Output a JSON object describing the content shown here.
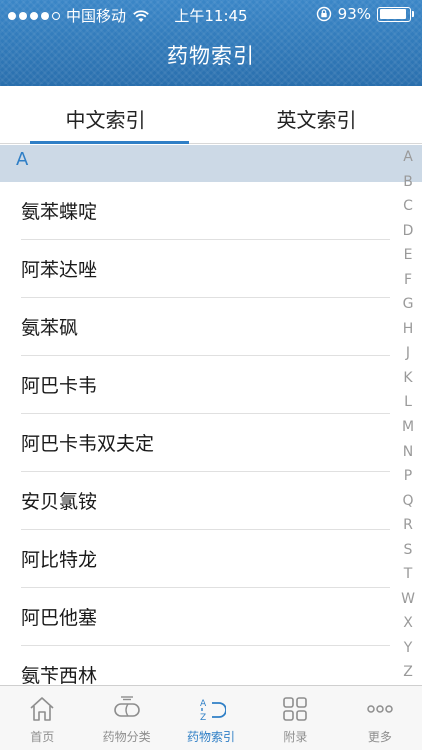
{
  "status_bar": {
    "carrier": "中国移动",
    "time": "上午11:45",
    "battery": "93%",
    "battery_level": 0.93
  },
  "header": {
    "title": "药物索引"
  },
  "tabs": [
    {
      "label": "中文索引"
    },
    {
      "label": "英文索引"
    }
  ],
  "section": {
    "letter": "A"
  },
  "items": [
    "氨苯蝶啶",
    "阿苯达唑",
    "氨苯砜",
    "阿巴卡韦",
    "阿巴卡韦双夫定",
    "安贝氯铵",
    "阿比特龙",
    "阿巴他塞",
    "氨苄西林"
  ],
  "alphabet": [
    "A",
    "B",
    "C",
    "D",
    "E",
    "F",
    "G",
    "H",
    "J",
    "K",
    "L",
    "M",
    "N",
    "P",
    "Q",
    "R",
    "S",
    "T",
    "W",
    "X",
    "Y",
    "Z"
  ],
  "tabbar": [
    {
      "label": "首页",
      "icon": "home-icon"
    },
    {
      "label": "药物分类",
      "icon": "pill-icon"
    },
    {
      "label": "药物索引",
      "icon": "az-index-icon"
    },
    {
      "label": "附录",
      "icon": "grid-icon"
    },
    {
      "label": "更多",
      "icon": "more-icon"
    }
  ],
  "colors": {
    "header": "#2f78b9",
    "accent": "#2f7fc6",
    "section_bg": "#ccd9e6",
    "inactive": "#8e8e8e"
  }
}
